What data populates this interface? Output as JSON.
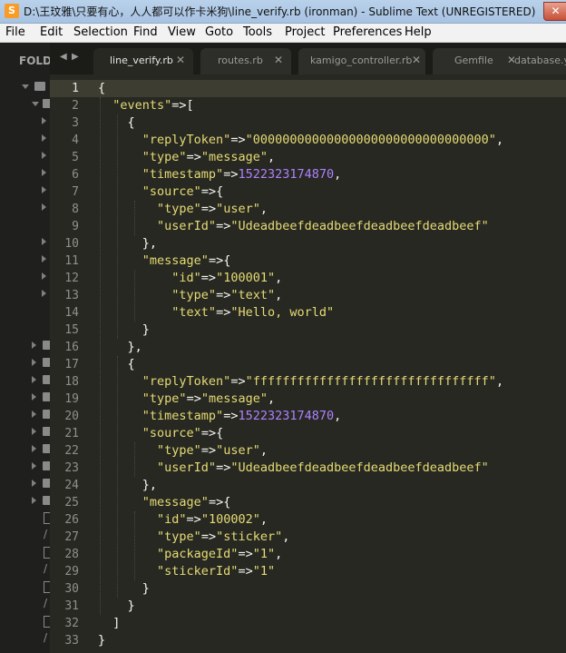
{
  "window": {
    "title": "D:\\王玟雅\\只要有心，人人都可以作卡米狗\\line_verify.rb (ironman) - Sublime Text (UNREGISTERED)",
    "close_glyph": "✕",
    "app_icon_glyph": "S"
  },
  "menu": [
    "File",
    "Edit",
    "Selection",
    "Find",
    "View",
    "Goto",
    "Tools",
    "Project",
    "Preferences",
    "Help"
  ],
  "sidebar": {
    "header": "FOLD"
  },
  "tabs": [
    {
      "label": "line_verify.rb",
      "active": true
    },
    {
      "label": "routes.rb",
      "active": false
    },
    {
      "label": "kamigo_controller.rb",
      "active": false
    },
    {
      "label": "Gemfile",
      "active": false
    },
    {
      "label": "database.yml",
      "active": false
    }
  ],
  "editor": {
    "current_line": 1,
    "lines": [
      [
        [
          "p",
          "{"
        ]
      ],
      [
        [
          "p",
          "  "
        ],
        [
          "s",
          "\"events\""
        ],
        [
          "p",
          "=>["
        ]
      ],
      [
        [
          "p",
          "    {"
        ]
      ],
      [
        [
          "p",
          "      "
        ],
        [
          "s",
          "\"replyToken\""
        ],
        [
          "p",
          "=>"
        ],
        [
          "s",
          "\"00000000000000000000000000000000\""
        ],
        [
          "p",
          ","
        ]
      ],
      [
        [
          "p",
          "      "
        ],
        [
          "s",
          "\"type\""
        ],
        [
          "p",
          "=>"
        ],
        [
          "s",
          "\"message\""
        ],
        [
          "p",
          ","
        ]
      ],
      [
        [
          "p",
          "      "
        ],
        [
          "s",
          "\"timestamp\""
        ],
        [
          "p",
          "=>"
        ],
        [
          "n",
          "1522323174870"
        ],
        [
          "p",
          ","
        ]
      ],
      [
        [
          "p",
          "      "
        ],
        [
          "s",
          "\"source\""
        ],
        [
          "p",
          "=>{"
        ]
      ],
      [
        [
          "p",
          "        "
        ],
        [
          "s",
          "\"type\""
        ],
        [
          "p",
          "=>"
        ],
        [
          "s",
          "\"user\""
        ],
        [
          "p",
          ","
        ]
      ],
      [
        [
          "p",
          "        "
        ],
        [
          "s",
          "\"userId\""
        ],
        [
          "p",
          "=>"
        ],
        [
          "s",
          "\"Udeadbeefdeadbeefdeadbeefdeadbeef\""
        ]
      ],
      [
        [
          "p",
          "      },"
        ]
      ],
      [
        [
          "p",
          "      "
        ],
        [
          "s",
          "\"message\""
        ],
        [
          "p",
          "=>{"
        ]
      ],
      [
        [
          "p",
          "          "
        ],
        [
          "s",
          "\"id\""
        ],
        [
          "p",
          "=>"
        ],
        [
          "s",
          "\"100001\""
        ],
        [
          "p",
          ","
        ]
      ],
      [
        [
          "p",
          "          "
        ],
        [
          "s",
          "\"type\""
        ],
        [
          "p",
          "=>"
        ],
        [
          "s",
          "\"text\""
        ],
        [
          "p",
          ","
        ]
      ],
      [
        [
          "p",
          "          "
        ],
        [
          "s",
          "\"text\""
        ],
        [
          "p",
          "=>"
        ],
        [
          "s",
          "\"Hello, world\""
        ]
      ],
      [
        [
          "p",
          "      }"
        ]
      ],
      [
        [
          "p",
          "    },"
        ]
      ],
      [
        [
          "p",
          "    {"
        ]
      ],
      [
        [
          "p",
          "      "
        ],
        [
          "s",
          "\"replyToken\""
        ],
        [
          "p",
          "=>"
        ],
        [
          "s",
          "\"ffffffffffffffffffffffffffffffff\""
        ],
        [
          "p",
          ","
        ]
      ],
      [
        [
          "p",
          "      "
        ],
        [
          "s",
          "\"type\""
        ],
        [
          "p",
          "=>"
        ],
        [
          "s",
          "\"message\""
        ],
        [
          "p",
          ","
        ]
      ],
      [
        [
          "p",
          "      "
        ],
        [
          "s",
          "\"timestamp\""
        ],
        [
          "p",
          "=>"
        ],
        [
          "n",
          "1522323174870"
        ],
        [
          "p",
          ","
        ]
      ],
      [
        [
          "p",
          "      "
        ],
        [
          "s",
          "\"source\""
        ],
        [
          "p",
          "=>{"
        ]
      ],
      [
        [
          "p",
          "        "
        ],
        [
          "s",
          "\"type\""
        ],
        [
          "p",
          "=>"
        ],
        [
          "s",
          "\"user\""
        ],
        [
          "p",
          ","
        ]
      ],
      [
        [
          "p",
          "        "
        ],
        [
          "s",
          "\"userId\""
        ],
        [
          "p",
          "=>"
        ],
        [
          "s",
          "\"Udeadbeefdeadbeefdeadbeefdeadbeef\""
        ]
      ],
      [
        [
          "p",
          "      },"
        ]
      ],
      [
        [
          "p",
          "      "
        ],
        [
          "s",
          "\"message\""
        ],
        [
          "p",
          "=>{"
        ]
      ],
      [
        [
          "p",
          "        "
        ],
        [
          "s",
          "\"id\""
        ],
        [
          "p",
          "=>"
        ],
        [
          "s",
          "\"100002\""
        ],
        [
          "p",
          ","
        ]
      ],
      [
        [
          "p",
          "        "
        ],
        [
          "s",
          "\"type\""
        ],
        [
          "p",
          "=>"
        ],
        [
          "s",
          "\"sticker\""
        ],
        [
          "p",
          ","
        ]
      ],
      [
        [
          "p",
          "        "
        ],
        [
          "s",
          "\"packageId\""
        ],
        [
          "p",
          "=>"
        ],
        [
          "s",
          "\"1\""
        ],
        [
          "p",
          ","
        ]
      ],
      [
        [
          "p",
          "        "
        ],
        [
          "s",
          "\"stickerId\""
        ],
        [
          "p",
          "=>"
        ],
        [
          "s",
          "\"1\""
        ]
      ],
      [
        [
          "p",
          "      }"
        ]
      ],
      [
        [
          "p",
          "    }"
        ]
      ],
      [
        [
          "p",
          "  ]"
        ]
      ],
      [
        [
          "p",
          "}"
        ]
      ]
    ]
  },
  "colors": {
    "editor_bg": "#272822",
    "string": "#e6db74",
    "number": "#ae81ff",
    "plain": "#f8f8f2",
    "line_number": "#8f908a"
  }
}
